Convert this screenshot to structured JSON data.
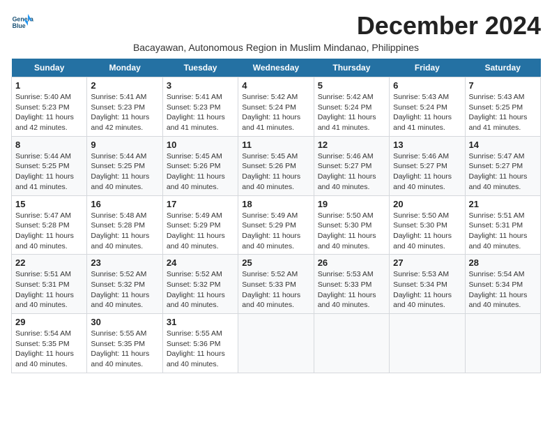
{
  "logo": {
    "line1": "General",
    "line2": "Blue"
  },
  "month_title": "December 2024",
  "location": "Bacayawan, Autonomous Region in Muslim Mindanao, Philippines",
  "days_of_week": [
    "Sunday",
    "Monday",
    "Tuesday",
    "Wednesday",
    "Thursday",
    "Friday",
    "Saturday"
  ],
  "weeks": [
    [
      {
        "day": "1",
        "sunrise": "5:40 AM",
        "sunset": "5:23 PM",
        "daylight": "11 hours and 42 minutes."
      },
      {
        "day": "2",
        "sunrise": "5:41 AM",
        "sunset": "5:23 PM",
        "daylight": "11 hours and 42 minutes."
      },
      {
        "day": "3",
        "sunrise": "5:41 AM",
        "sunset": "5:23 PM",
        "daylight": "11 hours and 41 minutes."
      },
      {
        "day": "4",
        "sunrise": "5:42 AM",
        "sunset": "5:24 PM",
        "daylight": "11 hours and 41 minutes."
      },
      {
        "day": "5",
        "sunrise": "5:42 AM",
        "sunset": "5:24 PM",
        "daylight": "11 hours and 41 minutes."
      },
      {
        "day": "6",
        "sunrise": "5:43 AM",
        "sunset": "5:24 PM",
        "daylight": "11 hours and 41 minutes."
      },
      {
        "day": "7",
        "sunrise": "5:43 AM",
        "sunset": "5:25 PM",
        "daylight": "11 hours and 41 minutes."
      }
    ],
    [
      {
        "day": "8",
        "sunrise": "5:44 AM",
        "sunset": "5:25 PM",
        "daylight": "11 hours and 41 minutes."
      },
      {
        "day": "9",
        "sunrise": "5:44 AM",
        "sunset": "5:25 PM",
        "daylight": "11 hours and 40 minutes."
      },
      {
        "day": "10",
        "sunrise": "5:45 AM",
        "sunset": "5:26 PM",
        "daylight": "11 hours and 40 minutes."
      },
      {
        "day": "11",
        "sunrise": "5:45 AM",
        "sunset": "5:26 PM",
        "daylight": "11 hours and 40 minutes."
      },
      {
        "day": "12",
        "sunrise": "5:46 AM",
        "sunset": "5:27 PM",
        "daylight": "11 hours and 40 minutes."
      },
      {
        "day": "13",
        "sunrise": "5:46 AM",
        "sunset": "5:27 PM",
        "daylight": "11 hours and 40 minutes."
      },
      {
        "day": "14",
        "sunrise": "5:47 AM",
        "sunset": "5:27 PM",
        "daylight": "11 hours and 40 minutes."
      }
    ],
    [
      {
        "day": "15",
        "sunrise": "5:47 AM",
        "sunset": "5:28 PM",
        "daylight": "11 hours and 40 minutes."
      },
      {
        "day": "16",
        "sunrise": "5:48 AM",
        "sunset": "5:28 PM",
        "daylight": "11 hours and 40 minutes."
      },
      {
        "day": "17",
        "sunrise": "5:49 AM",
        "sunset": "5:29 PM",
        "daylight": "11 hours and 40 minutes."
      },
      {
        "day": "18",
        "sunrise": "5:49 AM",
        "sunset": "5:29 PM",
        "daylight": "11 hours and 40 minutes."
      },
      {
        "day": "19",
        "sunrise": "5:50 AM",
        "sunset": "5:30 PM",
        "daylight": "11 hours and 40 minutes."
      },
      {
        "day": "20",
        "sunrise": "5:50 AM",
        "sunset": "5:30 PM",
        "daylight": "11 hours and 40 minutes."
      },
      {
        "day": "21",
        "sunrise": "5:51 AM",
        "sunset": "5:31 PM",
        "daylight": "11 hours and 40 minutes."
      }
    ],
    [
      {
        "day": "22",
        "sunrise": "5:51 AM",
        "sunset": "5:31 PM",
        "daylight": "11 hours and 40 minutes."
      },
      {
        "day": "23",
        "sunrise": "5:52 AM",
        "sunset": "5:32 PM",
        "daylight": "11 hours and 40 minutes."
      },
      {
        "day": "24",
        "sunrise": "5:52 AM",
        "sunset": "5:32 PM",
        "daylight": "11 hours and 40 minutes."
      },
      {
        "day": "25",
        "sunrise": "5:52 AM",
        "sunset": "5:33 PM",
        "daylight": "11 hours and 40 minutes."
      },
      {
        "day": "26",
        "sunrise": "5:53 AM",
        "sunset": "5:33 PM",
        "daylight": "11 hours and 40 minutes."
      },
      {
        "day": "27",
        "sunrise": "5:53 AM",
        "sunset": "5:34 PM",
        "daylight": "11 hours and 40 minutes."
      },
      {
        "day": "28",
        "sunrise": "5:54 AM",
        "sunset": "5:34 PM",
        "daylight": "11 hours and 40 minutes."
      }
    ],
    [
      {
        "day": "29",
        "sunrise": "5:54 AM",
        "sunset": "5:35 PM",
        "daylight": "11 hours and 40 minutes."
      },
      {
        "day": "30",
        "sunrise": "5:55 AM",
        "sunset": "5:35 PM",
        "daylight": "11 hours and 40 minutes."
      },
      {
        "day": "31",
        "sunrise": "5:55 AM",
        "sunset": "5:36 PM",
        "daylight": "11 hours and 40 minutes."
      },
      null,
      null,
      null,
      null
    ]
  ]
}
